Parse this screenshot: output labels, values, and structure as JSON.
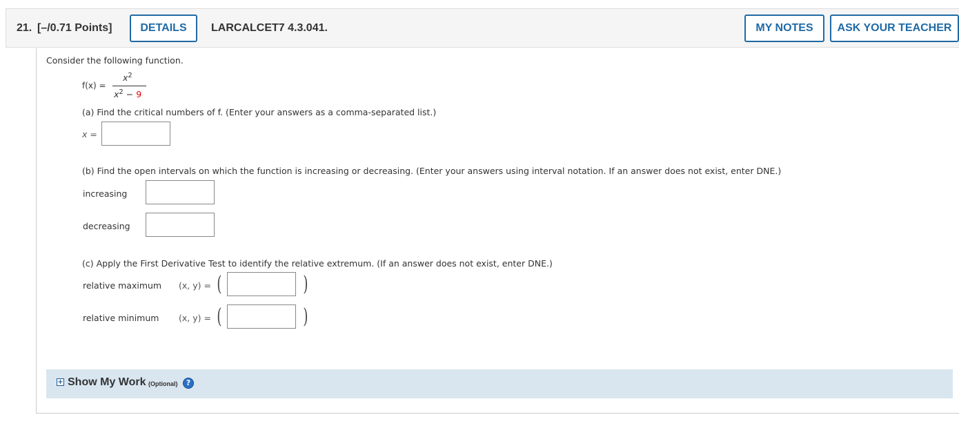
{
  "header": {
    "number": "21.",
    "points": "[–/0.71 Points]",
    "details_label": "DETAILS",
    "problem_id": "LARCALCET7 4.3.041.",
    "my_notes_label": "MY NOTES",
    "ask_teacher_label": "ASK YOUR TEACHER",
    "accent_color": "#1f6aa5"
  },
  "intro": "Consider the following function.",
  "function": {
    "lhs": "f(x) =",
    "numerator": "x",
    "num_exp": "2",
    "den_base": "x",
    "den_exp": "2",
    "den_minus": "−",
    "den_const": "9",
    "den_const_color": "#e00000"
  },
  "part_a": {
    "prompt": "(a) Find the critical numbers of f. (Enter your answers as a comma-separated list.)",
    "label": "x =",
    "value": ""
  },
  "part_b": {
    "prompt": "(b) Find the open intervals on which the function is increasing or decreasing. (Enter your answers using interval notation. If an answer does not exist, enter DNE.)",
    "increasing_label": "increasing",
    "increasing_value": "",
    "decreasing_label": "decreasing",
    "decreasing_value": ""
  },
  "part_c": {
    "prompt": "(c) Apply the First Derivative Test to identify the relative extremum. (If an answer does not exist, enter DNE.)",
    "max_label": "relative maximum",
    "min_label": "relative minimum",
    "xy_label": "(x, y) =",
    "open_paren": "(",
    "close_paren": ")",
    "max_value": "",
    "min_value": ""
  },
  "show_work": {
    "expand_icon": "plus-box-icon",
    "label": "Show My Work",
    "optional": "(Optional)",
    "help_icon": "question-circle-icon"
  }
}
